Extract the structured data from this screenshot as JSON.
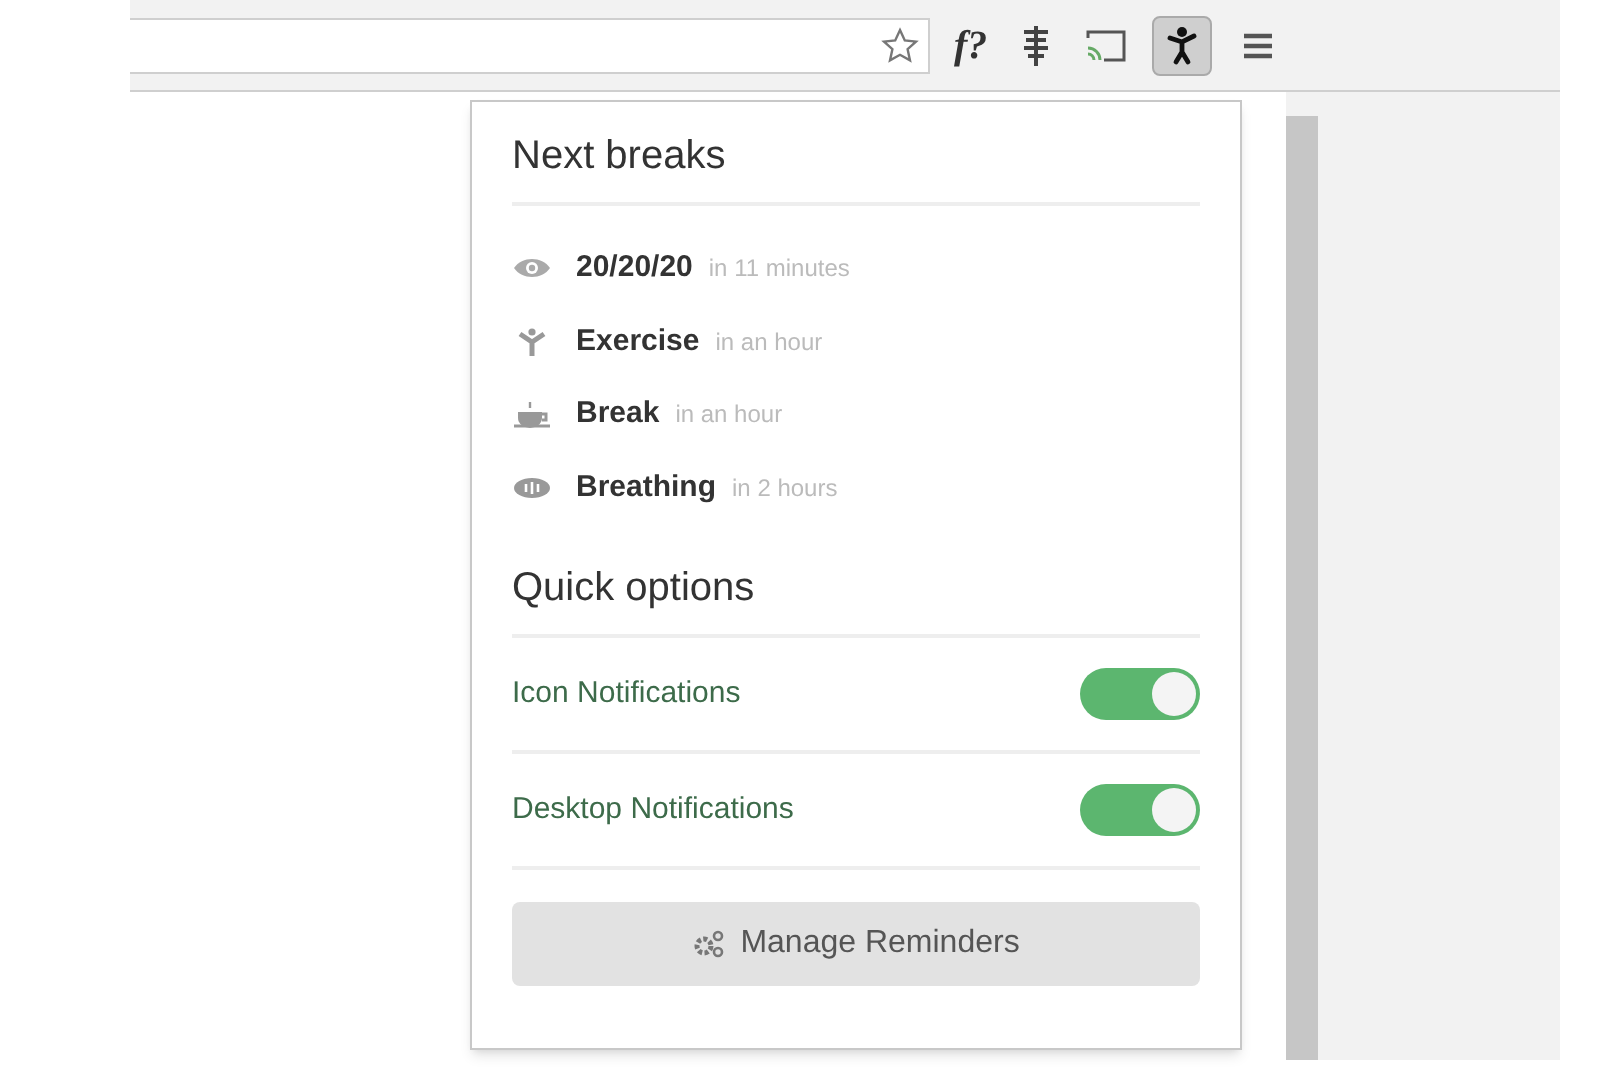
{
  "toolbar": {
    "font_button": "f?"
  },
  "popup": {
    "next_breaks": {
      "title": "Next breaks",
      "items": [
        {
          "kind": "eye",
          "name": "20/20/20",
          "time": "in 11 minutes"
        },
        {
          "kind": "exercise",
          "name": "Exercise",
          "time": "in an hour"
        },
        {
          "kind": "cup",
          "name": "Break",
          "time": "in an hour"
        },
        {
          "kind": "breathing",
          "name": "Breathing",
          "time": "in 2 hours"
        }
      ]
    },
    "quick_options": {
      "title": "Quick options",
      "toggles": [
        {
          "label": "Icon Notifications",
          "on": true
        },
        {
          "label": "Desktop Notifications",
          "on": true
        }
      ]
    },
    "manage_button": "Manage Reminders"
  }
}
